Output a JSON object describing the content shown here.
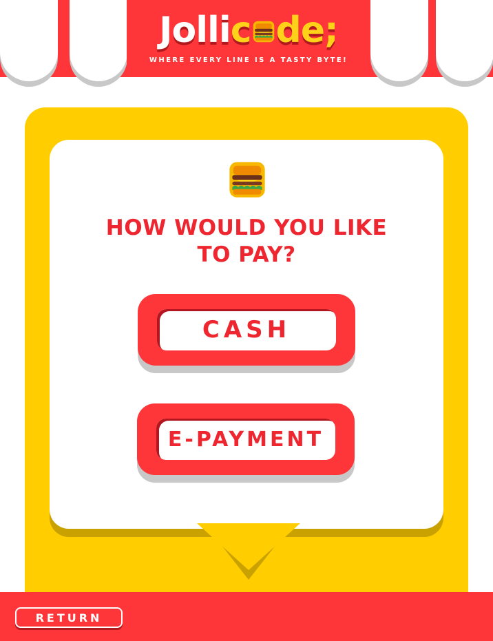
{
  "header": {
    "logo_prefix": "Jolli",
    "logo_c": "c",
    "logo_suffix": "de;",
    "tagline": "WHERE EVERY LINE IS A TASTY BYTE!"
  },
  "question": {
    "line1": "HOW WOULD YOU LIKE",
    "line2": "TO PAY?"
  },
  "options": {
    "cash_label": "CASH",
    "epayment_label": "E-PAYMENT"
  },
  "footer": {
    "return_label": "RETURN"
  },
  "colors": {
    "brand_red": "#fe363a",
    "accent_yellow": "#ffcd00",
    "text_red": "#ee2630"
  },
  "icons": {
    "logo_o": "burger-icon",
    "question": "burger-icon"
  }
}
